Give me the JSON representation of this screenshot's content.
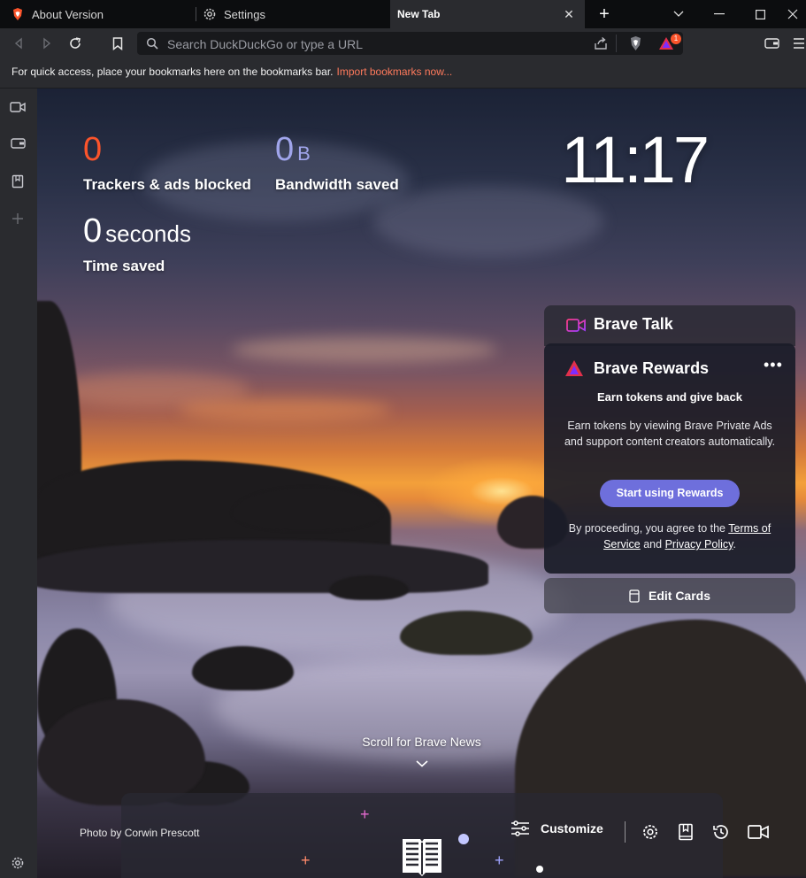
{
  "tabs": [
    {
      "label": "About Version",
      "icon": "brave-logo-icon"
    },
    {
      "label": "Settings",
      "icon": "gear-icon"
    },
    {
      "label": "New Tab",
      "active": true
    }
  ],
  "toolbar": {
    "url_placeholder": "Search DuckDuckGo or type a URL",
    "rewards_badge": "1"
  },
  "bookmarks_bar": {
    "message": "For quick access, place your bookmarks here on the bookmarks bar.",
    "import_link": "Import bookmarks now..."
  },
  "stats": {
    "trackers": {
      "value": "0",
      "label": "Trackers & ads blocked",
      "color": "#fb542b"
    },
    "bandwidth": {
      "value": "0",
      "unit": "B",
      "label": "Bandwidth saved",
      "color": "#a0a5eb"
    },
    "time": {
      "value": "0",
      "unit": "seconds",
      "label": "Time saved"
    }
  },
  "clock": "11:17",
  "brave_talk": {
    "title": "Brave Talk"
  },
  "brave_rewards": {
    "title": "Brave Rewards",
    "subtitle": "Earn tokens and give back",
    "body": "Earn tokens by viewing Brave Private Ads and support content creators automatically.",
    "button": "Start using Rewards",
    "legal_prefix": "By proceeding, you agree to the",
    "terms": "Terms of Service",
    "and": "and",
    "privacy": "Privacy Policy",
    "period": "."
  },
  "edit_cards": "Edit Cards",
  "scroll_news": "Scroll for Brave News",
  "photo_credit": {
    "prefix": "Photo by",
    "name": "Corwin Prescott"
  },
  "customize": "Customize"
}
